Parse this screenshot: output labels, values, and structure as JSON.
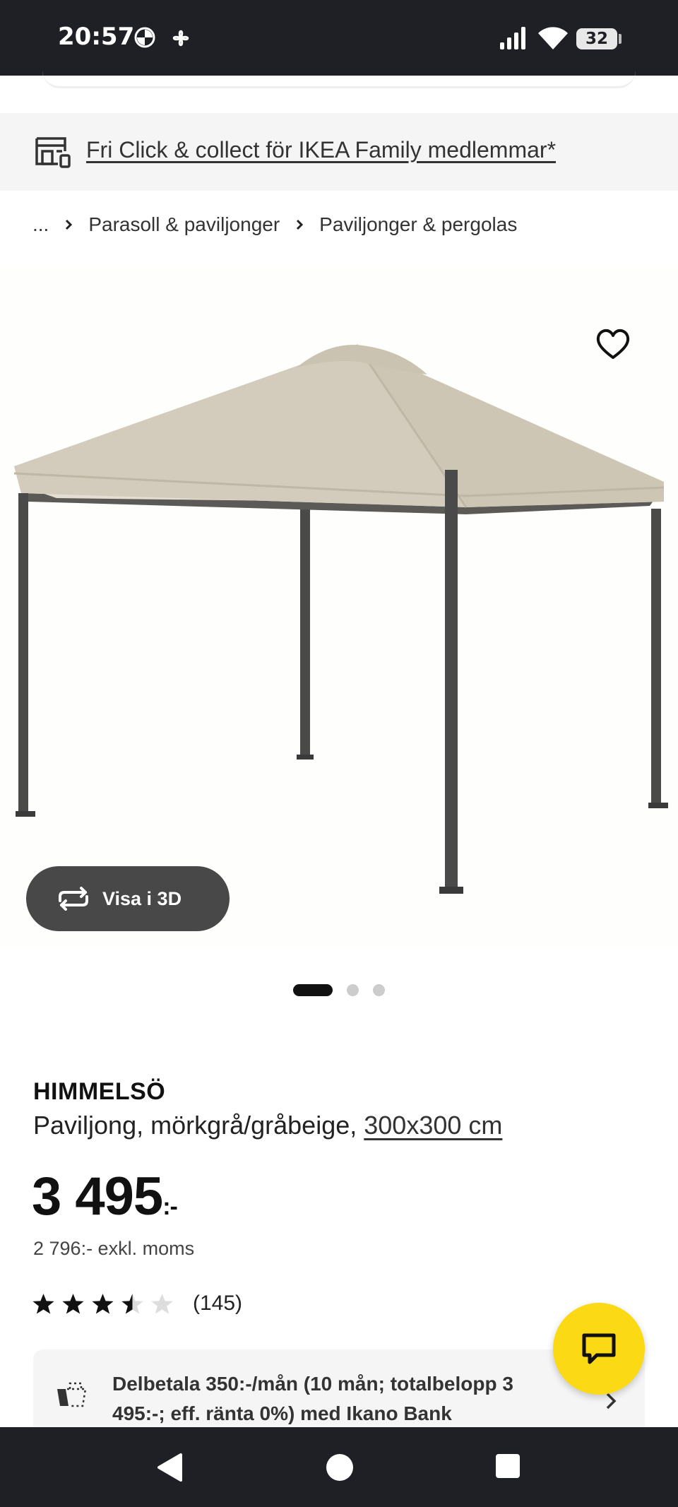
{
  "status_bar": {
    "time": "20:57",
    "battery": "32",
    "icons": [
      "bmw-icon",
      "fan-icon",
      "signal-icon",
      "wifi-icon",
      "battery-icon"
    ]
  },
  "banner": {
    "icon": "store-icon",
    "link_text": "Fri Click & collect för IKEA Family medlemmar*"
  },
  "breadcrumb": {
    "ellipsis": "...",
    "items": [
      "Parasoll & paviljonger",
      "Paviljonger & pergolas"
    ]
  },
  "gallery": {
    "view_3d_label": "Visa i 3D",
    "total_images": 3,
    "active_index": 0
  },
  "product": {
    "name": "HIMMELSÖ",
    "description": "Paviljong, mörkgrå/gråbeige,",
    "size": "300x300 cm",
    "price": "3 495",
    "price_suffix": ":-",
    "price_ex_vat": "2 796:- exkl. moms",
    "rating": 3.5,
    "rating_max": 5,
    "review_count": "(145)"
  },
  "installment": {
    "text": "Delbetala 350:-/mån (10 mån; totalbelopp 3 495:-; eff. ränta 0%) med Ikano Bank"
  },
  "colors": {
    "accent_yellow": "#fbd914",
    "system_bar": "#1f2026",
    "button_dark": "#484848"
  }
}
